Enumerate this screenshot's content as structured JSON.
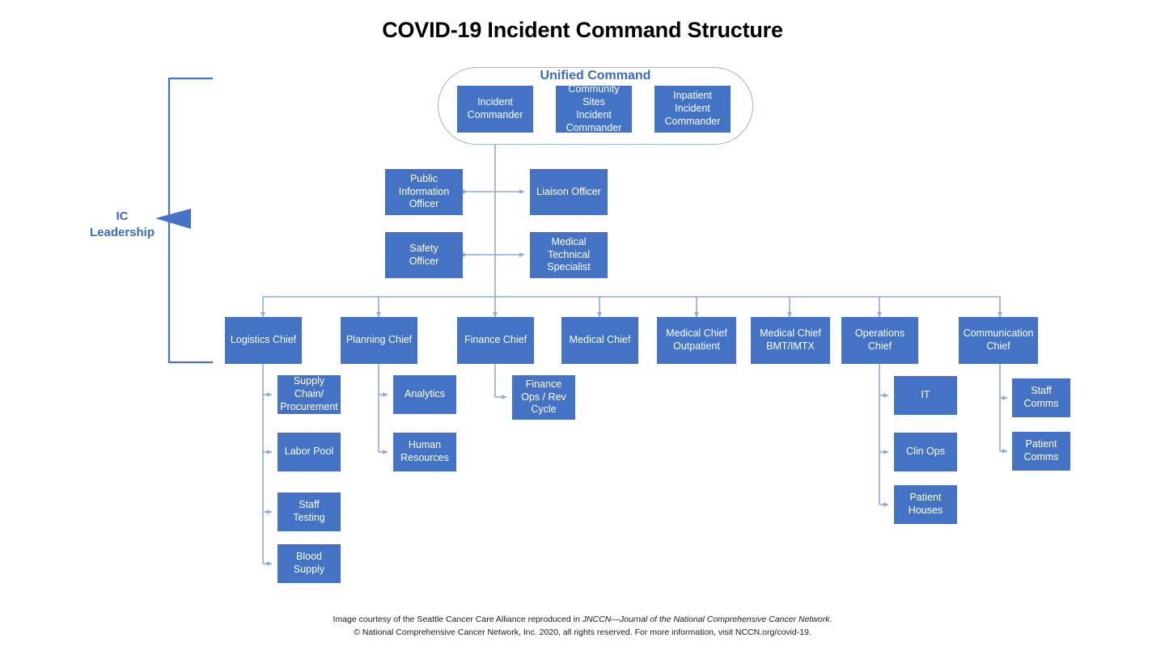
{
  "title": "COVID-19 Incident Command Structure",
  "colors": {
    "node_fill": "#4472C4",
    "node_text": "#FFFFFF",
    "connector": "#8FAADC",
    "accent_text": "#3B6AC4",
    "container_border": "#9DB4D4",
    "bracket": "#4472C4"
  },
  "unified_command": {
    "label": "Unified Command",
    "members": [
      {
        "label": "Incident\nCommander"
      },
      {
        "label": "Community\nSites\nIncident\nCommander"
      },
      {
        "label": "Inpatient\nIncident\nCommander"
      }
    ]
  },
  "ic_leadership": {
    "label": "IC\nLeadership"
  },
  "command_staff": [
    {
      "label": "Public\nInformation\nOfficer"
    },
    {
      "label": "Liaison Officer"
    },
    {
      "label": "Safety\nOfficer"
    },
    {
      "label": "Medical\nTechnical\nSpecialist"
    }
  ],
  "chiefs": [
    {
      "label": "Logistics Chief"
    },
    {
      "label": "Planning Chief"
    },
    {
      "label": "Finance Chief"
    },
    {
      "label": "Medical Chief"
    },
    {
      "label": "Medical Chief\nOutpatient"
    },
    {
      "label": "Medical Chief\nBMT/IMTX"
    },
    {
      "label": "Operations\nChief"
    },
    {
      "label": "Communication\nChief"
    }
  ],
  "logistics_units": [
    {
      "label": "Supply Chain/\nProcurement"
    },
    {
      "label": "Labor Pool"
    },
    {
      "label": "Staff\nTesting"
    },
    {
      "label": "Blood\nSupply"
    }
  ],
  "planning_units": [
    {
      "label": "Analytics"
    },
    {
      "label": "Human\nResources"
    }
  ],
  "finance_units": [
    {
      "label": "Finance\nOps / Rev\nCycle"
    }
  ],
  "operations_units": [
    {
      "label": "IT"
    },
    {
      "label": "Clin Ops"
    },
    {
      "label": "Patient\nHouses"
    }
  ],
  "communication_units": [
    {
      "label": "Staff\nComms"
    },
    {
      "label": "Patient\nComms"
    }
  ],
  "footer": {
    "line1_pre": "Image courtesy of the Seattle Cancer Care Alliance reproduced in ",
    "line1_italic": "JNCCN—Journal of the National Comprehensive Cancer Network",
    "line1_post": ".",
    "line2": "© National Comprehensive Cancer Network, Inc. 2020, all rights reserved. For more information, visit NCCN.org/covid-19."
  }
}
